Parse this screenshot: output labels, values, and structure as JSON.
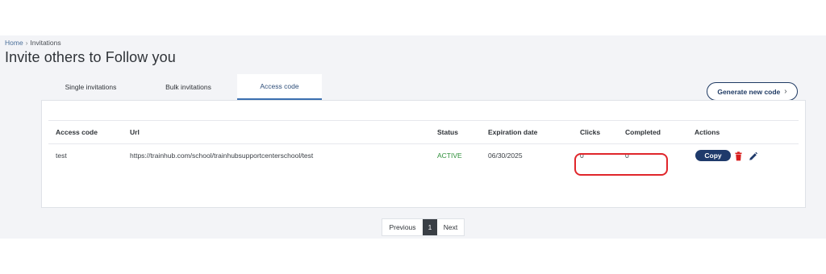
{
  "breadcrumb": {
    "home": "Home",
    "current": "Invitations"
  },
  "page": {
    "title": "Invite others to Follow you"
  },
  "tabs": [
    {
      "label": "Single invitations"
    },
    {
      "label": "Bulk invitations"
    },
    {
      "label": "Access code",
      "active": true
    }
  ],
  "generate_button": {
    "label": "Generate new code"
  },
  "table": {
    "headers": {
      "access_code": "Access code",
      "url": "Url",
      "status": "Status",
      "expiration": "Expiration date",
      "clicks": "Clicks",
      "completed": "Completed",
      "actions": "Actions"
    },
    "rows": [
      {
        "access_code": "test",
        "url": "https://trainhub.com/school/trainhubsupportcenterschool/test",
        "status": "ACTIVE",
        "expiration": "06/30/2025",
        "clicks": "0",
        "completed": "0",
        "copy_label": "Copy"
      }
    ]
  },
  "pagination": {
    "previous": "Previous",
    "current": "1",
    "next": "Next"
  },
  "colors": {
    "accent": "#1f3a6b",
    "status_active": "#2f8f3a",
    "highlight": "#e0262b",
    "delete": "#d81e1e"
  }
}
